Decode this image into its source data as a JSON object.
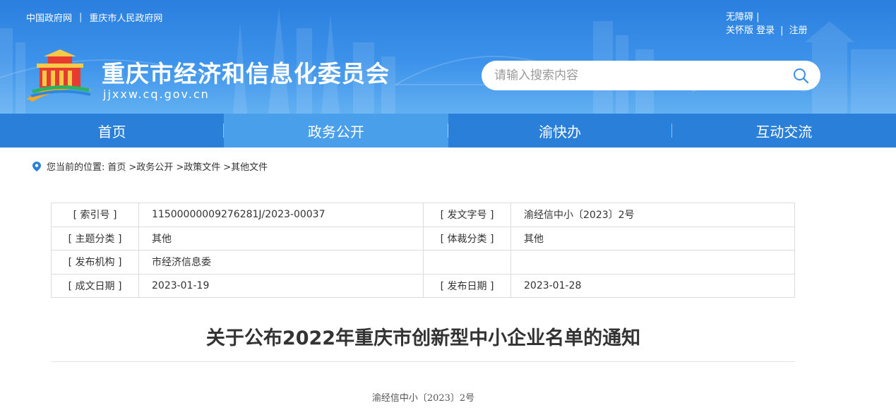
{
  "header": {
    "top_links": [
      "中国政府网",
      "重庆市人民政府网"
    ],
    "separator": "|",
    "accessibility": "无障碍",
    "elder_mode": "关怀版",
    "login": "登录",
    "register": "注册",
    "site_title": "重庆市经济和信息化委员会",
    "site_url": "jjxxw.cq.gov.cn",
    "search_placeholder": "请输入搜索内容",
    "colors": {
      "banner": "#3d93ea",
      "nav": "#2a7fd8",
      "nav_active": "#4a9fea"
    }
  },
  "nav": [
    {
      "label": "首页",
      "active": false
    },
    {
      "label": "政务公开",
      "active": true
    },
    {
      "label": "渝快办",
      "active": false
    },
    {
      "label": "互动交流",
      "active": false
    }
  ],
  "breadcrumb": {
    "prefix": "您当前的位置:",
    "items": [
      "首页",
      ">政务公开",
      ">政策文件",
      ">其他文件"
    ]
  },
  "info_table": {
    "rows": [
      {
        "label1": "[ 索引号 ]",
        "value1": "11500000009276281J/2023-00037",
        "label2": "[ 发文字号 ]",
        "value2": "渝经信中小〔2023〕2号"
      },
      {
        "label1": "[ 主题分类 ]",
        "value1": "其他",
        "label2": "[ 体裁分类 ]",
        "value2": "其他"
      },
      {
        "label1": "[ 发布机构 ]",
        "value1": "市经济信息委",
        "label2": "",
        "value2": ""
      },
      {
        "label1": "[ 成文日期 ]",
        "value1": "2023-01-19",
        "label2": "[ 发布日期 ]",
        "value2": "2023-01-28"
      }
    ]
  },
  "article": {
    "title": "关于公布2022年重庆市创新型中小企业名单的通知",
    "doc_number": "渝经信中小〔2023〕2号"
  }
}
